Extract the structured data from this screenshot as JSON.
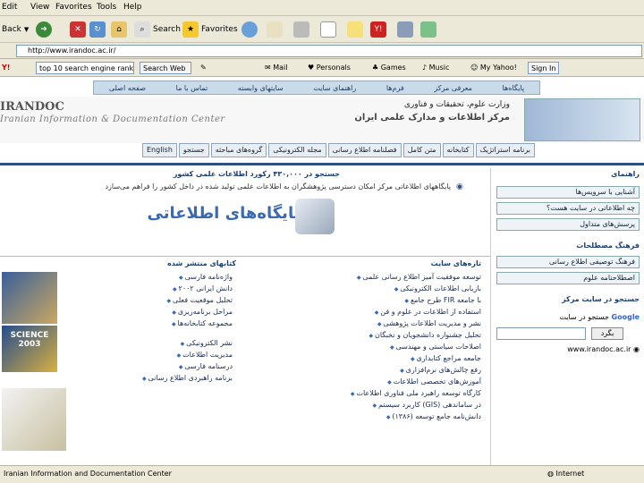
{
  "menubar": [
    "Edit",
    "View",
    "Favorites",
    "Tools",
    "Help"
  ],
  "nav": {
    "back": "Back",
    "search": "Search",
    "favorites": "Favorites"
  },
  "address": "http://www.irandoc.ac.ir/",
  "toolbar2": {
    "search_box": "top 10 search engine ranks",
    "search_web": "Search Web",
    "mail": "Mail",
    "personals": "Personals",
    "games": "Games",
    "music": "Music",
    "my_yahoo": "My Yahoo!",
    "sign_in": "Sign In"
  },
  "site": {
    "topnav": [
      "پایگاه‌ها",
      "معرفی مرکز",
      "فرم‌ها",
      "راهنمای سایت",
      "سایتهای وابسته",
      "تماس با ما",
      "صفحه اصلی"
    ],
    "logo": "IRANDOC",
    "logo_sub": "Iranian Information & Documentation Center",
    "ministry": "وزارت علوم، تحقیقات و فناوری",
    "center_name": "مرکز اطلاعات و مدارک علمی ایران",
    "menu2": [
      "برنامه استراتژیک",
      "کتابخانه",
      "متن کامل",
      "فصلنامه اطلاع رسانی",
      "مجله الکترونیکی",
      "گروه‌های مباحثه",
      "جستجو",
      "English"
    ],
    "search_banner": "جستجو در ۴۳۰,۰۰۰ رکورد اطلاعات علمی کشور",
    "intro": "پایگاههای اطلاعاتی مرکز امکان دسترسی پژوهشگران به اطلاعات علمی تولید شده در داخل کشور را فراهم می‌سازد",
    "databases_title": "پایگاه‌های اطلاعاتی",
    "published_title": "کتابهای منتشر شده",
    "published_items": [
      "واژه‌نامه فارسی",
      "دانش ایرانی ۲۰۰۲",
      "تحلیل موقعیت فعلی",
      "مراحل برنامه‌ریزی",
      "مجموعه کتابخانه‌ها"
    ],
    "publications2": [
      "نشر الکترونیکی",
      "مدیریت اطلاعات",
      "درسنامه فارسی",
      "برنامه راهبردی اطلاع رسانی"
    ],
    "news_title": "تازه‌های سایت",
    "news": [
      "توسعه موفقیت آمیز اطلاع رسانی علمی",
      "بازیابی اطلاعات الکترونیکی",
      "طرح جامع FIR با جامعه",
      "استفاده از اطلاعات در علوم و فن",
      "نشر و مدیریت اطلاعات پژوهشی",
      "تحلیل جشنواره دانشجویان و نخبگان",
      "اصلاحات سیاستی و مهندسی",
      "جامعه مراجع کتابداری",
      "رفع چالش‌های نرم‌افزاری",
      "آموزش‌های تخصصی اطلاعات",
      "کارگاه توسعه راهبرد ملی فناوری اطلاعات",
      "کاربرد سیستم (GIS) در ساماندهی",
      "دانش‌نامه جامع توسعه (۱۳۸۶)"
    ],
    "right": {
      "guide_title": "راهنمای",
      "guide_items": [
        "آشنایی با سرویس‌ها",
        "چه اطلاعاتی در سایت هست؟",
        "پرسش‌های متداول"
      ],
      "glossary_title": "فرهنگ مصطلحات",
      "glossary_items": [
        "فرهنگ توصیفی اطلاع رسانی",
        "اصطلاحنامه علوم"
      ],
      "search_title": "جستجو در سایت مرکز",
      "google_label": "جستجو در سایت",
      "search_button": "بگرد",
      "site_url": "www.irandoc.ac.ir"
    }
  },
  "status": {
    "text": "Iranian Information and Documentation Center",
    "zone": "Internet"
  },
  "colors": {
    "accent": "#2c4f86",
    "chrome": "#ece9d8"
  }
}
